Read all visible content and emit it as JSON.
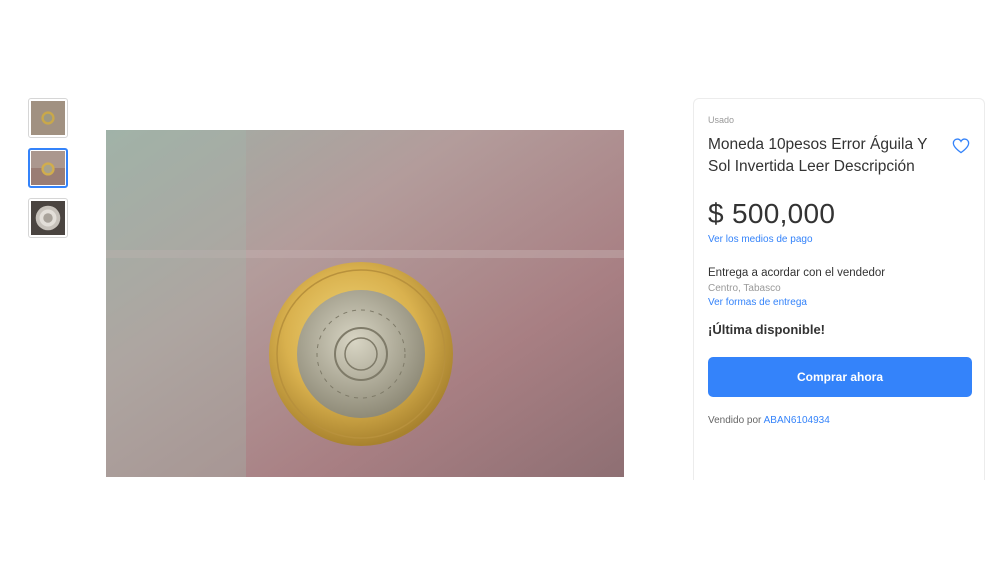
{
  "thumbnails": [
    {
      "name": "thumbnail-1",
      "label": ""
    },
    {
      "name": "thumbnail-2",
      "label": ""
    },
    {
      "name": "thumbnail-3",
      "label": ""
    }
  ],
  "product": {
    "condition": "Usado",
    "title": "Moneda 10pesos Error Águila Y Sol Invertida Leer Descripción",
    "price": "$ 500,000",
    "payment_link": "Ver los medios de pago",
    "delivery": "Entrega a acordar con el vendedor",
    "location": "Centro, Tabasco",
    "shipping_link": "Ver formas de entrega",
    "stock": "¡Última disponible!",
    "buy_label": "Comprar ahora",
    "seller_prefix": "Vendido por",
    "seller_name": "ABAN6104934"
  },
  "icons": {
    "favorite": "heart-outline-icon"
  },
  "colors": {
    "accent": "#3483fa",
    "text": "#333333",
    "muted": "#999999"
  }
}
